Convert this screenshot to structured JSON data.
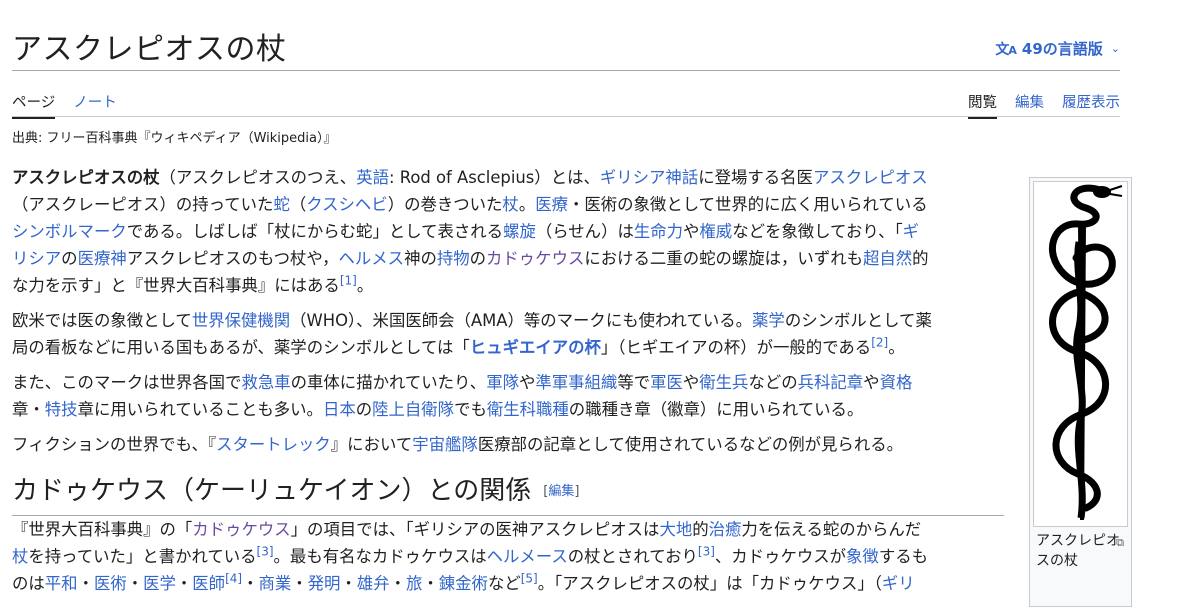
{
  "header": {
    "title": "アスクレピオスの杖",
    "lang_icon": "文",
    "lang_icon_sub": "A",
    "lang_label": "49の言語版",
    "lang_chevron": "⌄"
  },
  "tabs": {
    "left": [
      {
        "label": "ページ",
        "selected": true
      },
      {
        "label": "ノート",
        "selected": false
      }
    ],
    "right": [
      {
        "label": "閲覧",
        "selected": true
      },
      {
        "label": "編集",
        "selected": false
      },
      {
        "label": "履歴表示",
        "selected": false
      }
    ]
  },
  "source_line": "出典: フリー百科事典『ウィキペディア（Wikipedia）』",
  "paragraphs": [
    [
      {
        "t": "アスクレピオスの杖",
        "b": true
      },
      {
        "t": "（アスクレピオスのつえ、"
      },
      {
        "t": "英語",
        "l": true
      },
      {
        "t": ": Rod of Asclepius）とは、"
      },
      {
        "t": "ギリシア神話",
        "l": true
      },
      {
        "t": "に登場する名医"
      },
      {
        "t": "アスクレピオス",
        "l": true
      },
      {
        "br": true
      },
      {
        "t": "（アスクレーピオス）の持っていた"
      },
      {
        "t": "蛇",
        "l": true
      },
      {
        "t": "（"
      },
      {
        "t": "クスシヘビ",
        "l": true
      },
      {
        "t": "）の巻きついた"
      },
      {
        "t": "杖",
        "l": true
      },
      {
        "t": "。"
      },
      {
        "t": "医療",
        "l": true
      },
      {
        "t": "・医術の象徴として世界的に広く用いられている"
      },
      {
        "br": true
      },
      {
        "t": "シンボルマーク",
        "l": true
      },
      {
        "t": "である。しばしば「杖にからむ蛇」として表される"
      },
      {
        "t": "螺旋",
        "l": true
      },
      {
        "t": "（らせん）は"
      },
      {
        "t": "生命力",
        "l": true
      },
      {
        "t": "や"
      },
      {
        "t": "権威",
        "l": true
      },
      {
        "t": "などを象徴しており、「"
      },
      {
        "t": "ギ",
        "l": true
      },
      {
        "br": true
      },
      {
        "t": "リシア",
        "l": true
      },
      {
        "t": "の"
      },
      {
        "t": "医療神",
        "l": true
      },
      {
        "t": "アスクレピオスのもつ杖や，"
      },
      {
        "t": "ヘルメス",
        "l": true
      },
      {
        "t": "神の"
      },
      {
        "t": "持物",
        "l": true
      },
      {
        "t": "の"
      },
      {
        "t": "カドゥケウス",
        "v": true
      },
      {
        "t": "における二重の蛇の螺旋は，いずれも"
      },
      {
        "t": "超自然",
        "l": true
      },
      {
        "t": "的"
      },
      {
        "br": true
      },
      {
        "t": "な力を示す」と『世界大百科事典』にはある"
      },
      {
        "t": "[1]",
        "sup": true
      },
      {
        "t": "。"
      }
    ],
    [
      {
        "t": "欧米では医の象徴として"
      },
      {
        "t": "世界保健機関",
        "l": true
      },
      {
        "t": "（WHO）、米国医師会（AMA）等のマークにも使われている。"
      },
      {
        "t": "薬学",
        "l": true
      },
      {
        "t": "のシンボルとして薬"
      },
      {
        "br": true
      },
      {
        "t": "局の看板などに用いる国もあるが、薬学のシンボルとしては「"
      },
      {
        "t": "ヒュギエイアの杯",
        "l": true,
        "b": true
      },
      {
        "t": "」（ヒギエイアの杯）が一般的である"
      },
      {
        "t": "[2]",
        "sup": true
      },
      {
        "t": "。"
      }
    ],
    [
      {
        "t": "また、このマークは世界各国で"
      },
      {
        "t": "救急車",
        "l": true
      },
      {
        "t": "の車体に描かれていたり、"
      },
      {
        "t": "軍隊",
        "l": true
      },
      {
        "t": "や"
      },
      {
        "t": "準軍事組織",
        "l": true
      },
      {
        "t": "等で"
      },
      {
        "t": "軍医",
        "l": true
      },
      {
        "t": "や"
      },
      {
        "t": "衛生兵",
        "l": true
      },
      {
        "t": "などの"
      },
      {
        "t": "兵科記章",
        "l": true
      },
      {
        "t": "や"
      },
      {
        "t": "資格",
        "l": true
      },
      {
        "br": true
      },
      {
        "t": "章・"
      },
      {
        "t": "特技",
        "l": true
      },
      {
        "t": "章に用いられていることも多い。"
      },
      {
        "t": "日本",
        "l": true
      },
      {
        "t": "の"
      },
      {
        "t": "陸上自衛隊",
        "l": true
      },
      {
        "t": "でも"
      },
      {
        "t": "衛生科職種",
        "l": true
      },
      {
        "t": "の職種き章（徽章）に用いられている。"
      }
    ],
    [
      {
        "t": "フィクションの世界でも、『"
      },
      {
        "t": "スタートレック",
        "l": true
      },
      {
        "t": "』において"
      },
      {
        "t": "宇宙艦隊",
        "l": true
      },
      {
        "t": "医療部の記章として使用されているなどの例が見られる。"
      }
    ]
  ],
  "section": {
    "heading": "カドゥケウス（ケーリュケイオン）との関係",
    "edit_open": "[",
    "edit_label": "編集",
    "edit_close": "]",
    "body": [
      {
        "t": "『世界大百科事典』の「"
      },
      {
        "t": "カドゥケウス",
        "v": true
      },
      {
        "t": "」の項目では、「ギリシアの医神アスクレピオスは"
      },
      {
        "t": "大地",
        "l": true
      },
      {
        "t": "的"
      },
      {
        "t": "治癒",
        "l": true
      },
      {
        "t": "力を伝える蛇のからんだ"
      },
      {
        "br": true
      },
      {
        "t": "杖",
        "l": true
      },
      {
        "t": "を持っていた」と書かれている"
      },
      {
        "t": "[3]",
        "sup": true
      },
      {
        "t": "。最も有名なカドゥケウスは"
      },
      {
        "t": "ヘルメース",
        "l": true
      },
      {
        "t": "の杖とされており"
      },
      {
        "t": "[3]",
        "sup": true
      },
      {
        "t": "、カドゥケウスが"
      },
      {
        "t": "象徴",
        "l": true
      },
      {
        "t": "するも"
      },
      {
        "br": true
      },
      {
        "t": "のは"
      },
      {
        "t": "平和",
        "l": true
      },
      {
        "t": "・"
      },
      {
        "t": "医術",
        "l": true
      },
      {
        "t": "・"
      },
      {
        "t": "医学",
        "l": true
      },
      {
        "t": "・"
      },
      {
        "t": "医師",
        "l": true
      },
      {
        "t": "[4]",
        "sup": true
      },
      {
        "t": "・"
      },
      {
        "t": "商業",
        "l": true
      },
      {
        "t": "・"
      },
      {
        "t": "発明",
        "l": true
      },
      {
        "t": "・"
      },
      {
        "t": "雄弁",
        "l": true
      },
      {
        "t": "・"
      },
      {
        "t": "旅",
        "l": true
      },
      {
        "t": "・"
      },
      {
        "t": "錬金術",
        "l": true
      },
      {
        "t": "など"
      },
      {
        "t": "[5]",
        "sup": true
      },
      {
        "t": "。「アスクレピオスの杖」は「カドゥケウス」（"
      },
      {
        "t": "ギリ",
        "l": true
      }
    ]
  },
  "infobox": {
    "image_icon": "rod-of-asclepius-icon",
    "caption": "アスクレピオスの杖",
    "magnify_glyph": "⧉"
  },
  "colors": {
    "link": "#3366cc",
    "visited_link": "#6b4ba1",
    "text": "#202122"
  }
}
